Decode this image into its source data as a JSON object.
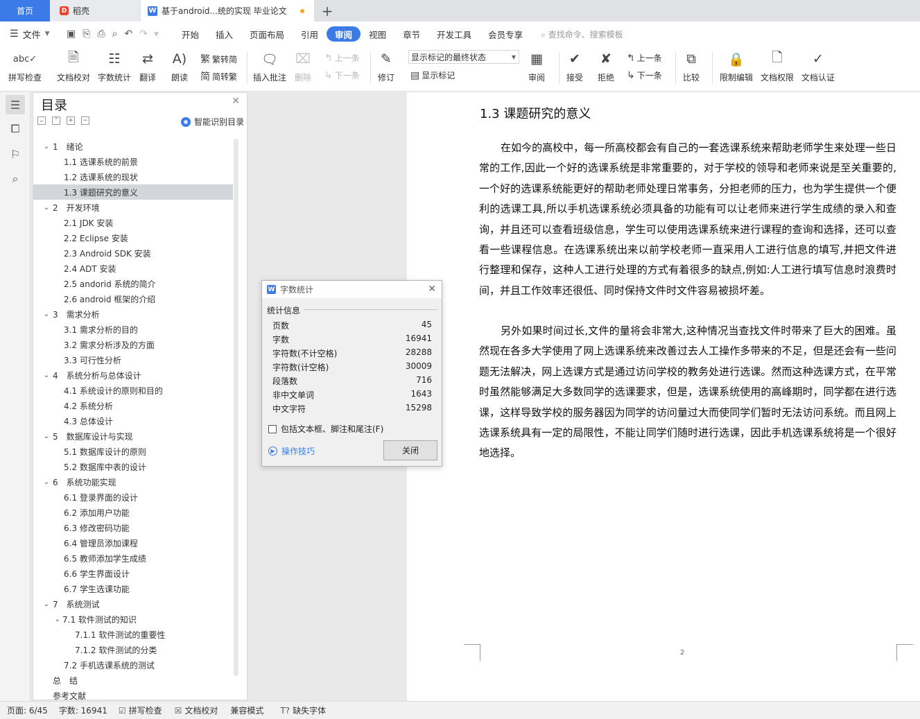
{
  "tabs": {
    "home": "首页",
    "daoke": "稻壳",
    "doc": "基于android...统的实现 毕业论文"
  },
  "menubar": {
    "file": "文件",
    "tabs": [
      "开始",
      "插入",
      "页面布局",
      "引用",
      "审阅",
      "视图",
      "章节",
      "开发工具",
      "会员专享"
    ],
    "active_tab": "审阅",
    "search": "查找命令、搜索模板"
  },
  "ribbon": {
    "spellcheck": "拼写检查",
    "doc_proof": "文档校对",
    "word_count": "字数统计",
    "translate": "翻译",
    "read_aloud": "朗读",
    "to_traditional": "繁转简",
    "to_simplified": "简转繁",
    "insert_comment": "插入批注",
    "delete": "删除",
    "prev_comment": "上一条",
    "next_comment": "下一条",
    "track_changes": "修订",
    "markup_state": "显示标记的最终状态",
    "show_markup": "显示标记",
    "review": "审阅",
    "accept": "接受",
    "reject": "拒绝",
    "prev_change": "上一条",
    "next_change": "下一条",
    "compare": "比较",
    "restrict_edit": "限制编辑",
    "doc_permission": "文档权限",
    "doc_cert": "文档认证"
  },
  "toc": {
    "title": "目录",
    "smart": "智能识别目录",
    "items": [
      {
        "label": "1　绪论",
        "level": 1
      },
      {
        "label": "1.1  选课系统的前景",
        "level": 2
      },
      {
        "label": "1.2  选课系统的现状",
        "level": 2
      },
      {
        "label": "1.3  课题研究的意义",
        "level": 2,
        "selected": true
      },
      {
        "label": "2　开发环境",
        "level": 1
      },
      {
        "label": "2.1 JDK 安装",
        "level": 2
      },
      {
        "label": "2.2 Eclipse 安装",
        "level": 2
      },
      {
        "label": "2.3 Android SDK 安装",
        "level": 2
      },
      {
        "label": "2.4 ADT 安装",
        "level": 2
      },
      {
        "label": "2.5 andorid 系统的简介",
        "level": 2
      },
      {
        "label": "2.6 android 框架的介绍",
        "level": 2
      },
      {
        "label": "3　需求分析",
        "level": 1
      },
      {
        "label": "3.1 需求分析的目的",
        "level": 2
      },
      {
        "label": "3.2 需求分析涉及的方面",
        "level": 2
      },
      {
        "label": "3.3 可行性分析",
        "level": 2
      },
      {
        "label": "4　系统分析与总体设计",
        "level": 1
      },
      {
        "label": "4.1 系统设计的原则和目的",
        "level": 2
      },
      {
        "label": "4.2 系统分析",
        "level": 2
      },
      {
        "label": "4.3  总体设计",
        "level": 2
      },
      {
        "label": "5　数据库设计与实现",
        "level": 1
      },
      {
        "label": "5.1 数据库设计的原则",
        "level": 2
      },
      {
        "label": "5.2 数据库中表的设计",
        "level": 2
      },
      {
        "label": "6　系统功能实现",
        "level": 1
      },
      {
        "label": "6.1 登录界面的设计",
        "level": 2
      },
      {
        "label": "6.2 添加用户功能",
        "level": 2
      },
      {
        "label": "6.3 修改密码功能",
        "level": 2
      },
      {
        "label": "6.4 管理员添加课程",
        "level": 2
      },
      {
        "label": "6.5 教师添加学生成绩",
        "level": 2
      },
      {
        "label": "6.6 学生界面设计",
        "level": 2
      },
      {
        "label": "6.7 学生选课功能",
        "level": 2
      },
      {
        "label": "7　系统测试",
        "level": 1
      },
      {
        "label": "7.1  软件测试的知识",
        "level": "2c"
      },
      {
        "label": "7.1.1  软件测试的重要性",
        "level": 3
      },
      {
        "label": "7.1.2  软件测试的分类",
        "level": 3
      },
      {
        "label": "7.2 手机选课系统的测试",
        "level": 2
      },
      {
        "label": "总　结",
        "level": 0
      },
      {
        "label": "参考文献",
        "level": 0
      }
    ]
  },
  "document": {
    "heading": "1.3  课题研究的意义",
    "para1": "在如今的高校中，每一所高校都会有自己的一套选课系统来帮助老师学生来处理一些日常的工作,因此一个好的选课系统是非常重要的，对于学校的领导和老师来说是至关重要的,一个好的选课系统能更好的帮助老师处理日常事务，分担老师的压力，也为学生提供一个便利的选课工具,所以手机选课系统必须具备的功能有可以让老师来进行学生成绩的录入和查询，并且还可以查看班级信息，学生可以使用选课系统来进行课程的查询和选择，还可以查看一些课程信息。在选课系统出来以前学校老师一直采用人工进行信息的填写,并把文件进行整理和保存，这种人工进行处理的方式有着很多的缺点,例如:人工进行填写信息时浪费时间，并且工作效率还很低、同时保持文件时文件容易被损坏差。",
    "para2": "另外如果时间过长,文件的量将会非常大,这种情况当查找文件时带来了巨大的困难。虽然现在各多大学使用了网上选课系统来改善过去人工操作多带来的不足，但是还会有一些问题无法解决，网上选课方式是通过访问学校的教务处进行选课。然而这种选课方式，在平常时虽然能够满足大多数同学的选课要求，但是，选课系统使用的高峰期时，同学都在进行选课，这样导致学校的服务器因为同学的访问量过大而使同学们暂时无法访问系统。而且网上选课系统具有一定的局限性，不能让同学们随时进行选课，因此手机选课系统将是一个很好地选择。",
    "page_number": "2"
  },
  "dialog": {
    "title": "字数统计",
    "group": "统计信息",
    "stats": [
      {
        "label": "页数",
        "value": "45"
      },
      {
        "label": "字数",
        "value": "16941"
      },
      {
        "label": "字符数(不计空格)",
        "value": "28288"
      },
      {
        "label": "字符数(计空格)",
        "value": "30009"
      },
      {
        "label": "段落数",
        "value": "716"
      },
      {
        "label": "非中文单词",
        "value": "1643"
      },
      {
        "label": "中文字符",
        "value": "15298"
      }
    ],
    "include_label": "包括文本框、脚注和尾注(F)",
    "tips": "操作技巧",
    "close": "关闭"
  },
  "status": {
    "page": "页面: 6/45",
    "words": "字数: 16941",
    "spell": "拼写检查",
    "proof": "文档校对",
    "compat": "兼容模式",
    "missing_font": "缺失字体"
  }
}
